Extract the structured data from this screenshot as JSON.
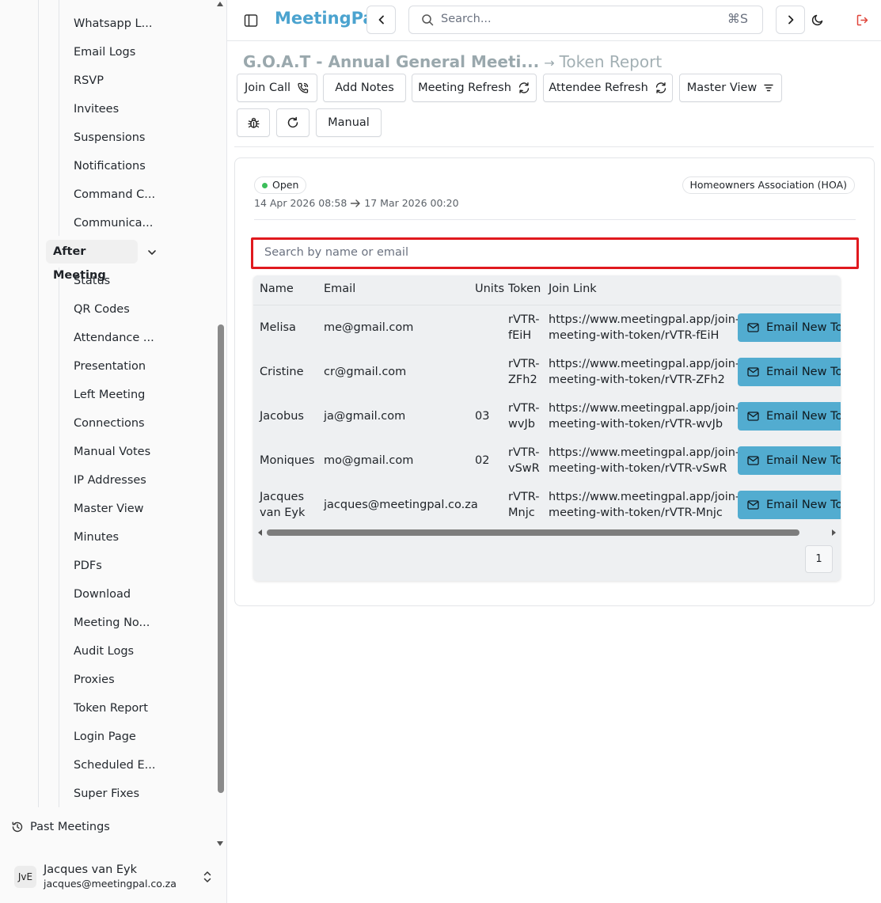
{
  "sidebar": {
    "items_top": [
      "Whatsapp L...",
      "Email Logs",
      "RSVP",
      "Invitees",
      "Suspensions",
      "Notifications",
      "Command C...",
      "Communica..."
    ],
    "group_label": "After Meeting",
    "items_after": [
      "Status",
      "QR Codes",
      "Attendance ...",
      "Presentation",
      "Left Meeting",
      "Connections",
      "Manual Votes",
      "IP Addresses",
      "Master View",
      "Minutes",
      "PDFs",
      "Download",
      "Meeting No...",
      "Audit Logs",
      "Proxies",
      "Token Report",
      "Login Page",
      "Scheduled E...",
      "Super Fixes"
    ],
    "past_meetings": "Past Meetings",
    "user": {
      "initials": "JvE",
      "name": "Jacques van Eyk",
      "email": "jacques@meetingpal.co.za"
    }
  },
  "topbar": {
    "brand": "MeetingPal",
    "search_placeholder": "Search...",
    "shortcut": "⌘S"
  },
  "page": {
    "meeting_title": "G.O.A.T - Annual General Meeti...",
    "page_title": "Token Report",
    "buttons": {
      "join_call": "Join Call",
      "add_notes": "Add Notes",
      "meeting_refresh": "Meeting Refresh",
      "attendee_refresh": "Attendee Refresh",
      "master_view": "Master View",
      "manual": "Manual"
    }
  },
  "meeting": {
    "status": "Open",
    "organisation": "Homeowners Association (HOA)",
    "start": "14 Apr 2026 08:58",
    "end": "17 Mar 2026 00:20"
  },
  "table": {
    "filter_placeholder": "Search by name or email",
    "headers": {
      "name": "Name",
      "email": "Email",
      "units": "Units",
      "token": "Token",
      "join_link": "Join Link"
    },
    "action_label": "Email New Tok",
    "rows": [
      {
        "name": [
          "Melisa"
        ],
        "email": "me@gmail.com",
        "units": "",
        "token": [
          "rVTR-",
          "fEiH"
        ],
        "link": [
          "https://www.meetingpal.app/join-",
          "meeting-with-token/rVTR-fEiH"
        ]
      },
      {
        "name": [
          "Cristine"
        ],
        "email": "cr@gmail.com",
        "units": "",
        "token": [
          "rVTR-",
          "ZFh2"
        ],
        "link": [
          "https://www.meetingpal.app/join-",
          "meeting-with-token/rVTR-ZFh2"
        ]
      },
      {
        "name": [
          "Jacobus"
        ],
        "email": "ja@gmail.com",
        "units": "03",
        "token": [
          "rVTR-",
          "wvJb"
        ],
        "link": [
          "https://www.meetingpal.app/join-",
          "meeting-with-token/rVTR-wvJb"
        ]
      },
      {
        "name": [
          "Moniques"
        ],
        "email": "mo@gmail.com",
        "units": "02",
        "token": [
          "rVTR-",
          "vSwR"
        ],
        "link": [
          "https://www.meetingpal.app/join-",
          "meeting-with-token/rVTR-vSwR"
        ]
      },
      {
        "name": [
          "Jacques",
          "van Eyk"
        ],
        "email": "jacques@meetingpal.co.za",
        "units": "",
        "token": [
          "rVTR-",
          "Mnjc"
        ],
        "link": [
          "https://www.meetingpal.app/join-",
          "meeting-with-token/rVTR-Mnjc"
        ]
      }
    ],
    "page": "1"
  },
  "colors": {
    "brand": "#4ba3cf",
    "action": "#52acd0",
    "highlight": "#e0191e",
    "status_open": "#3cbe5a"
  }
}
